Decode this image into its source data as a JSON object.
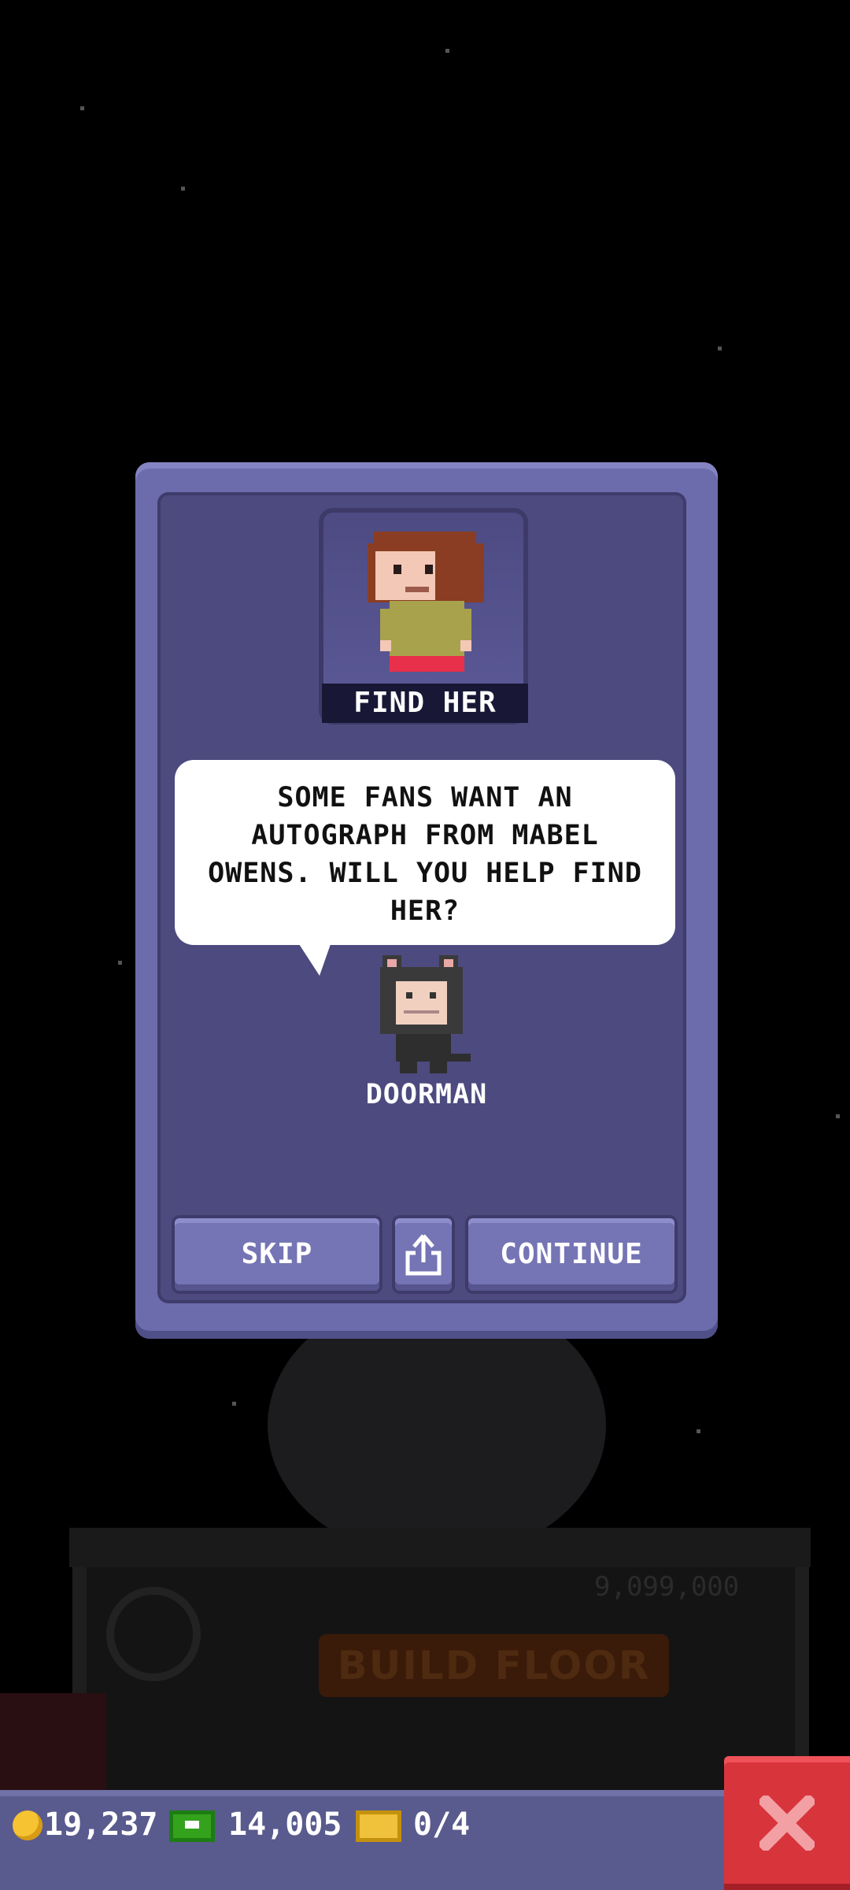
{
  "quest": {
    "title": "FIND HER",
    "message": "SOME FANS WANT AN AUTOGRAPH FROM MABEL OWENS. WILL YOU HELP FIND HER?",
    "speaker": "DOORMAN"
  },
  "buttons": {
    "skip": "SKIP",
    "continue": "CONTINUE",
    "share_icon": "share-icon"
  },
  "tower": {
    "build_label": "BUILD FLOOR",
    "cost": "9,099,000"
  },
  "status_bar": {
    "coins": "19,237",
    "cash": "14,005",
    "tickets": "0/4"
  },
  "colors": {
    "modal_frame": "#6c6bab",
    "modal_inner": "#4d4a7f",
    "button": "#7574b4",
    "close_button": "#d8343c",
    "bottom_bar": "#595a8d"
  }
}
